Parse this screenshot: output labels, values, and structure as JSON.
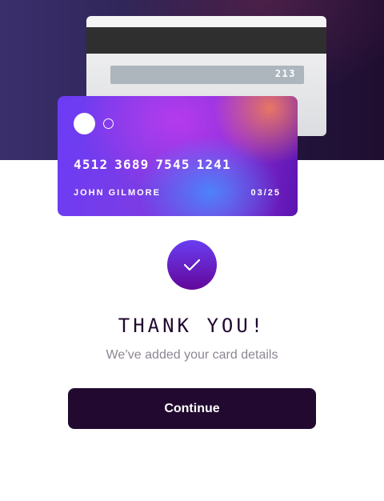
{
  "card_back": {
    "cvc": "213"
  },
  "card_front": {
    "number": "4512 3689 7545 1241",
    "holder_name": "JOHN GILMORE",
    "expiry": "03/25"
  },
  "status": {
    "icon": "checkmark-icon",
    "title": "THANK YOU!",
    "subtitle": "We’ve added your card details"
  },
  "actions": {
    "continue_label": "Continue"
  },
  "colors": {
    "primary": "#21092f",
    "muted_text": "#8e8593",
    "accent_gradient_start": "#6a3ef2",
    "accent_gradient_end": "#63079a"
  }
}
